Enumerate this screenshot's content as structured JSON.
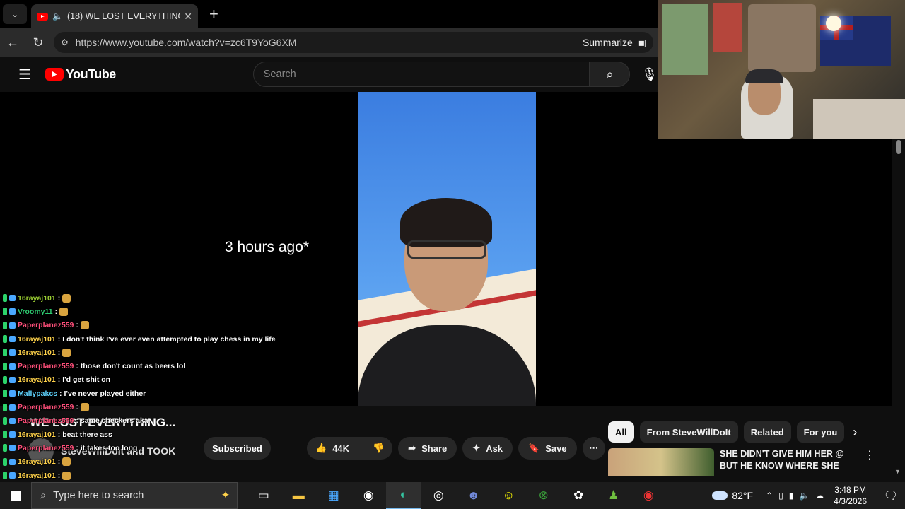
{
  "browser": {
    "tab_title": "(18) WE LOST EVERYTHING...",
    "url": "https://www.youtube.com/watch?v=zc6T9YoG6XM",
    "summarize_label": "Summarize"
  },
  "youtube": {
    "logo_text": "YouTube",
    "search_placeholder": "Search"
  },
  "player": {
    "overlay_text": "3 hours ago*"
  },
  "video": {
    "title": "WE LOST EVERYTHING...",
    "channel": "SteveWillDoIt and TOOK",
    "subscribe_label": "Subscribed",
    "likes": "44K",
    "share_label": "Share",
    "ask_label": "Ask",
    "save_label": "Save"
  },
  "sidebar": {
    "chips": [
      "All",
      "From SteveWillDoIt",
      "Related",
      "For you"
    ],
    "recommendation_title": "SHE DIDN'T GIVE HIM HER @ BUT HE KNOW WHERE SHE ..."
  },
  "chat": [
    {
      "user": "16rayaj101",
      "color": "#9acd32",
      "text": ""
    },
    {
      "user": "Vroomy11",
      "color": "#2ecc71",
      "text": ""
    },
    {
      "user": "Paperplanez559",
      "color": "#ff4f7a",
      "text": ""
    },
    {
      "user": "16rayaj101",
      "color": "#ffd24a",
      "text": "I don't think I've ever even attempted to play chess in my life"
    },
    {
      "user": "16rayaj101",
      "color": "#ffd24a",
      "text": ""
    },
    {
      "user": "Paperplanez559",
      "color": "#ff4f7a",
      "text": "those don't count as beers lol"
    },
    {
      "user": "16rayaj101",
      "color": "#ffd24a",
      "text": "I'd get shit on"
    },
    {
      "user": "Mallypakcs",
      "color": "#5fd4ff",
      "text": "I've never played either"
    },
    {
      "user": "Paperplanez559",
      "color": "#ff4f7a",
      "text": ""
    },
    {
      "user": "Paperplanez559",
      "color": "#ff4f7a",
      "text": "same checkers aka"
    },
    {
      "user": "16rayaj101",
      "color": "#ffd24a",
      "text": "beat there ass"
    },
    {
      "user": "Paperplanez559",
      "color": "#ff4f7a",
      "text": "it takes too long"
    },
    {
      "user": "16rayaj101",
      "color": "#ffd24a",
      "text": ""
    },
    {
      "user": "16rayaj101",
      "color": "#ffd24a",
      "text": ""
    },
    {
      "user": "16rayaj101",
      "color": "#ffd24a",
      "text": ""
    },
    {
      "user": "16rayaj101",
      "color": "#ffd24a",
      "text": ""
    }
  ],
  "taskbar": {
    "search_placeholder": "Type here to search",
    "temperature": "82°F",
    "time": "3:48 PM",
    "date": "4/3/2026"
  }
}
